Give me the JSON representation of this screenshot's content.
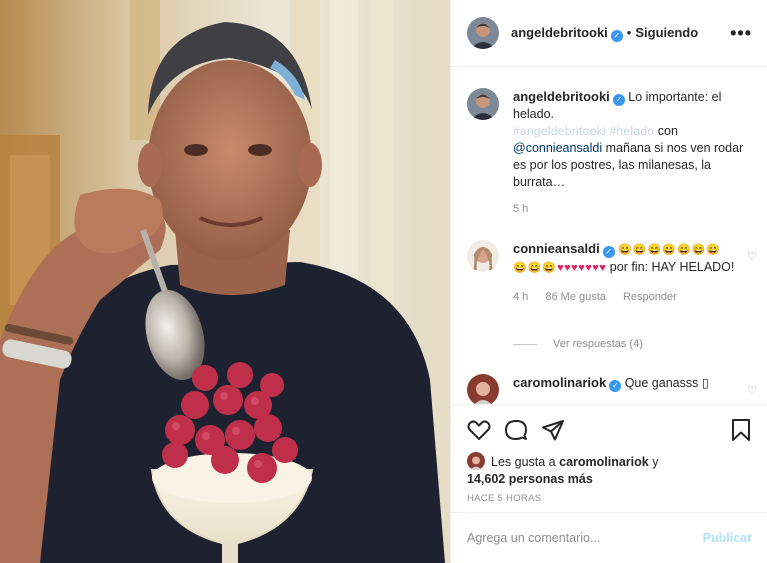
{
  "post": {
    "author": "angeldebritooki",
    "follow_status": "Siguiendo",
    "separator": "•",
    "more_label": "•••"
  },
  "caption": {
    "author": "angeldebritooki",
    "text_1": "Lo importante: el helado.",
    "hashtags": "#angeldebritooki #helado",
    "text_2": "con",
    "mention": "@connieansaldi",
    "text_3": "mañana si nos ven rodar es por los postres, las milanesas, la burrata…",
    "time": "5 h"
  },
  "comments": [
    {
      "author": "connieansaldi",
      "faces_1": "😄😄😄😄😄😄😄",
      "faces_2": "😄😄😄",
      "hearts": "♥♥♥♥♥♥♥",
      "text": "por fin: HAY HELADO!",
      "time": "4 h",
      "likes": "86 Me gusta",
      "reply": "Responder",
      "view_replies": "Ver respuestas (4)"
    },
    {
      "author": "caromolinariok",
      "text": "Que ganasss ▯"
    }
  ],
  "likes": {
    "prefix": "Les gusta a",
    "user": "caromolinariok",
    "conj": "y",
    "others": "14,602 personas más"
  },
  "posted_ago": "HACE 5 HORAS",
  "composer": {
    "placeholder": "Agrega un comentario...",
    "publish": "Publicar"
  },
  "colors": {
    "accent": "#3897f0",
    "publish_disabled": "#b2dffc",
    "heart": "#e0245e",
    "muted_text": "#8e8e8e"
  },
  "icons": [
    "more-options-icon",
    "verified-badge-icon",
    "like-heart-icon",
    "comment-bubble-icon",
    "share-plane-icon",
    "bookmark-icon"
  ]
}
